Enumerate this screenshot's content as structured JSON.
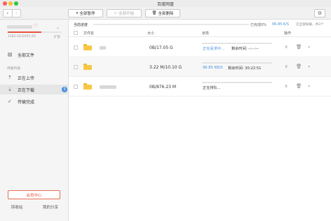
{
  "window": {
    "title": "百度网盘"
  },
  "toolbar": {
    "back_glyph": "‹",
    "forward_glyph": "›",
    "pause_all": "全部暂停",
    "start_all": "全部开始",
    "delete_all": "全部删除",
    "pause_icon": "⏸",
    "start_icon": "▷",
    "delete_icon": "🗑",
    "settings_icon": "⚙"
  },
  "sidebar": {
    "storage": "1283.5G/2055.0G",
    "storage_fraction": 0.625,
    "expand": "扩容",
    "all_files": "全部文件",
    "transfer_section": "传输列表",
    "uploading": "正在上传",
    "downloading": "正在下载",
    "downloading_badge": "3",
    "completed": "传输完成",
    "vip_center": "会员中心",
    "trash": "回收站",
    "my_share": "我的分享"
  },
  "main": {
    "overall_label": "当前进度",
    "overall_progress": 0.0,
    "overall_done": "已完成0%",
    "overall_speed": "96.85 K/S",
    "overall_note": "已全部加载，共3个",
    "columns": {
      "name": "文件名",
      "size": "大小",
      "status": "状态",
      "ops": "操作"
    },
    "rows": [
      {
        "size": "0B/17.05 G",
        "status_a": "正在请求中...",
        "status_a_color": "blue",
        "status_b": "剩余时间: --:--:--",
        "progress": 0.0
      },
      {
        "size": "3.22 M/10.10 G",
        "status_a": "96.85 KB/S",
        "status_a_color": "blue",
        "status_b": "剩余时间: 30:22:51",
        "progress": 0.0
      },
      {
        "size": "0B/876.23 M",
        "status_a": "正在排队...",
        "status_a_color": "dark",
        "status_b": "",
        "progress": 0.0
      }
    ]
  },
  "colors": {
    "accent": "#4a90e2",
    "brand": "#e8533b",
    "folder": "#f7c744"
  }
}
